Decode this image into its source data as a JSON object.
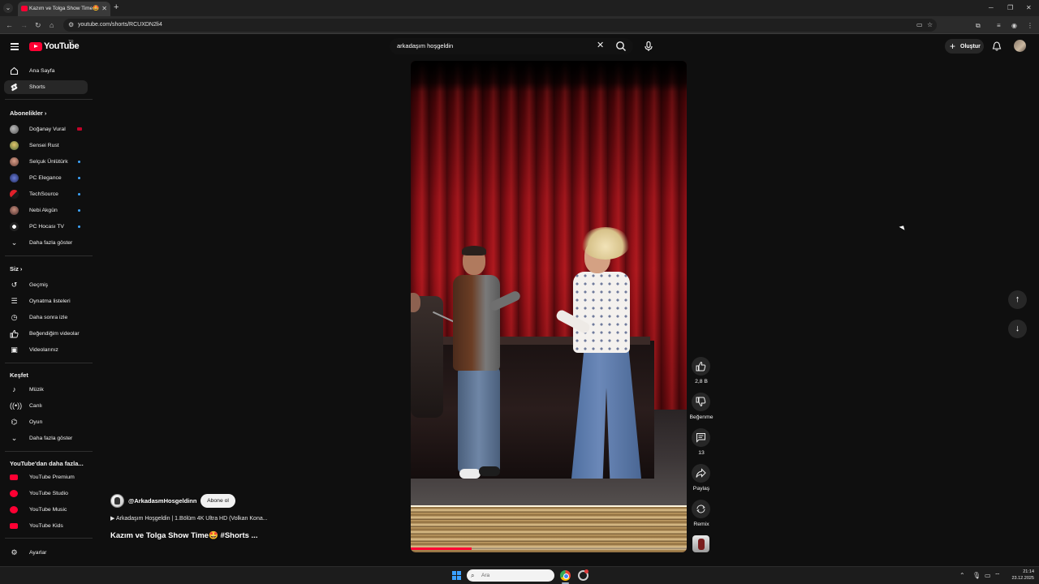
{
  "browser": {
    "tab_title": "Kazım ve Tolga Show Time🤩 #",
    "url": "youtube.com/shorts/RCUXDN2li4"
  },
  "masthead": {
    "logo_text": "YouTube",
    "country_code": "TR",
    "search_value": "arkadaşım hoşgeldin",
    "create_label": "Oluştur"
  },
  "sidebar": {
    "main": [
      {
        "label": "Ana Sayfa",
        "icon": "home-icon"
      },
      {
        "label": "Shorts",
        "icon": "shorts-icon",
        "active": true
      }
    ],
    "subscriptions_header": "Abonelikler",
    "subscriptions": [
      {
        "label": "Doğanay Vural",
        "badge": "live"
      },
      {
        "label": "Sensei Rust"
      },
      {
        "label": "Selçuk Ünlütürk",
        "badge": "new"
      },
      {
        "label": "PC Elegance",
        "badge": "new"
      },
      {
        "label": "TechSource",
        "badge": "new"
      },
      {
        "label": "Nebi Akgün",
        "badge": "new"
      },
      {
        "label": "PC Hocası TV",
        "badge": "new"
      }
    ],
    "subs_more": "Daha fazla göster",
    "you_header": "Siz",
    "you": [
      {
        "label": "Geçmiş",
        "icon": "history-icon"
      },
      {
        "label": "Oynatma listeleri",
        "icon": "playlists-icon"
      },
      {
        "label": "Daha sonra izle",
        "icon": "watch-later-icon"
      },
      {
        "label": "Beğendiğim videolar",
        "icon": "liked-videos-icon"
      },
      {
        "label": "Videolarınız",
        "icon": "your-videos-icon"
      }
    ],
    "explore_header": "Keşfet",
    "explore": [
      {
        "label": "Müzik",
        "icon": "music-icon"
      },
      {
        "label": "Canlı",
        "icon": "live-icon"
      },
      {
        "label": "Oyun",
        "icon": "gaming-icon"
      }
    ],
    "explore_more": "Daha fazla göster",
    "more_header": "YouTube'dan daha fazla...",
    "more": [
      {
        "label": "YouTube Premium"
      },
      {
        "label": "YouTube Studio"
      },
      {
        "label": "YouTube Music"
      },
      {
        "label": "YouTube Kids"
      }
    ],
    "settings": "Ayarlar"
  },
  "short": {
    "channel": "@ArkadasmHosgeldinn",
    "subscribe_label": "Abone ol",
    "video_link": "▶ Arkadaşım Hoşgeldin | 1.Bölüm 4K Ultra HD (Volkan Kona...",
    "title": "Kazım ve Tolga Show Time🤩 #Shorts ...",
    "progress": 0.22
  },
  "actions": {
    "likes": "2,8 B",
    "dislike_label": "Beğenme",
    "comments": "13",
    "share_label": "Paylaş",
    "remix_label": "Remix"
  },
  "taskbar": {
    "search_placeholder": "Ara",
    "time": "21:14",
    "date": "23.12.2025"
  }
}
